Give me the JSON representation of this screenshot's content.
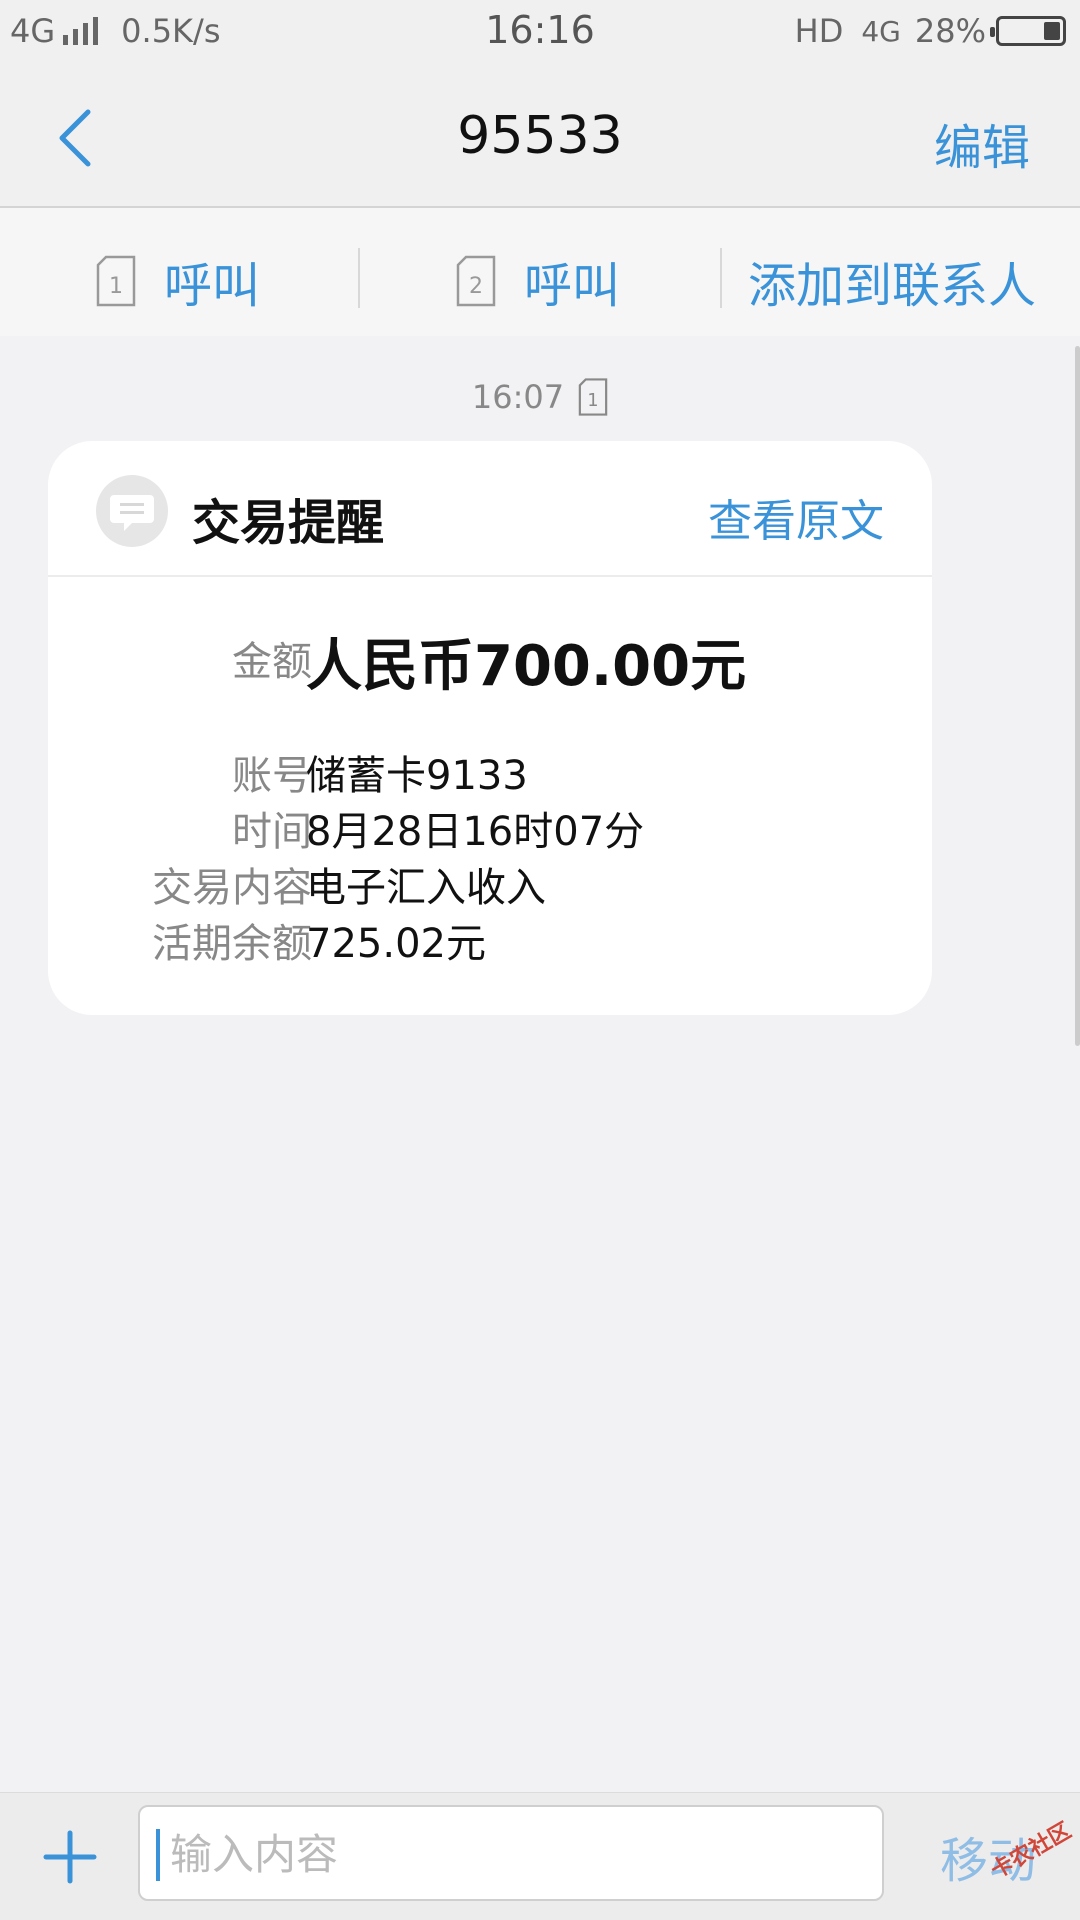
{
  "status_bar": {
    "network": "4G",
    "speed": "0.5K/s",
    "time": "16:16",
    "hd": "HD",
    "data_type": "4G",
    "battery": "28%",
    "battery_level": 0.28
  },
  "header": {
    "title": "95533",
    "edit_label": "编辑"
  },
  "actions": {
    "sim1_number": "1",
    "sim1_call": "呼叫",
    "sim2_number": "2",
    "sim2_call": "呼叫",
    "add_contact": "添加到联系人"
  },
  "message": {
    "time": "16:07",
    "sim_number": "1",
    "card_title": "交易提醒",
    "view_original": "查看原文",
    "fields": [
      {
        "label": "金额",
        "value": "人民币700.00元"
      },
      {
        "label": "账号",
        "value": "储蓄卡9133"
      },
      {
        "label": "时间",
        "value": "8月28日16时07分"
      },
      {
        "label": "交易内容",
        "value": "电子汇入收入"
      },
      {
        "label": "活期余额",
        "value": "725.02元"
      }
    ]
  },
  "composer": {
    "placeholder": "输入内容",
    "send_label": "移动",
    "watermark": "卡农社区"
  },
  "colors": {
    "accent": "#3a93d8",
    "background": "#f2f2f4"
  }
}
